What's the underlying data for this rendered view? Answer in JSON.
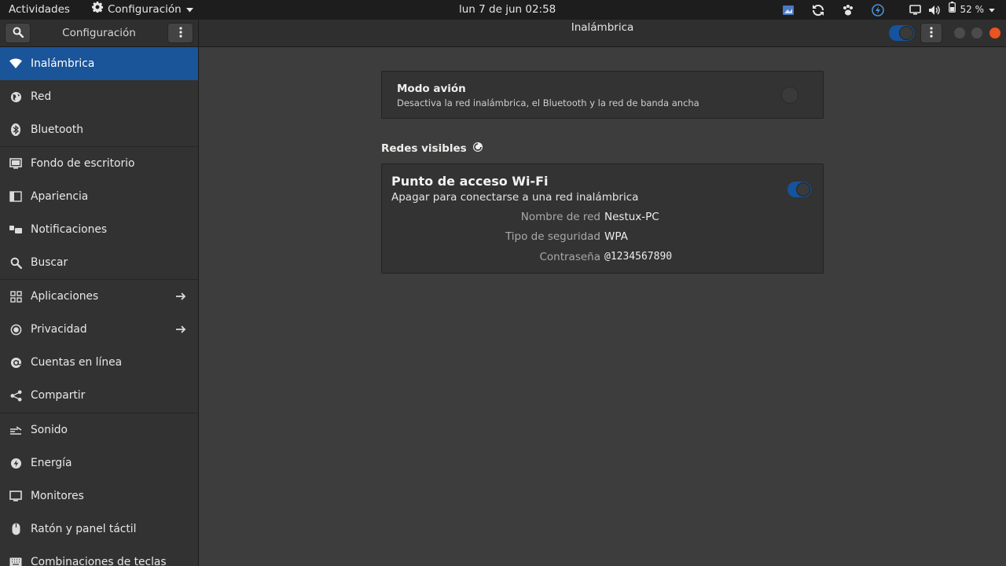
{
  "topbar": {
    "activities": "Actividades",
    "app_menu": "Configuración",
    "clock": "lun  7 de jun  02:58",
    "battery": "52 %",
    "tray_icons": [
      "screenshot-icon",
      "sync-icon",
      "paw-icon",
      "power-circle-icon",
      "display-icon",
      "volume-icon",
      "battery-icon"
    ]
  },
  "header": {
    "left_title": "Configuración",
    "title": "Inalámbrica"
  },
  "sidebar": {
    "items": [
      {
        "label": "Inalámbrica",
        "icon": "wifi-icon"
      },
      {
        "label": "Red",
        "icon": "globe-icon"
      },
      {
        "label": "Bluetooth",
        "icon": "bluetooth-icon"
      },
      {
        "label": "Fondo de escritorio",
        "icon": "monitor-icon"
      },
      {
        "label": "Apariencia",
        "icon": "appearance-icon"
      },
      {
        "label": "Notificaciones",
        "icon": "notifications-icon"
      },
      {
        "label": "Buscar",
        "icon": "search-icon"
      },
      {
        "label": "Aplicaciones",
        "icon": "grid-icon"
      },
      {
        "label": "Privacidad",
        "icon": "privacy-icon"
      },
      {
        "label": "Cuentas en línea",
        "icon": "at-icon"
      },
      {
        "label": "Compartir",
        "icon": "share-icon"
      },
      {
        "label": "Sonido",
        "icon": "sound-icon"
      },
      {
        "label": "Energía",
        "icon": "power-icon"
      },
      {
        "label": "Monitores",
        "icon": "display-icon"
      },
      {
        "label": "Ratón y panel táctil",
        "icon": "mouse-icon"
      },
      {
        "label": "Combinaciones de teclas",
        "icon": "keyboard-icon"
      }
    ]
  },
  "main": {
    "airplane": {
      "title": "Modo avión",
      "subtitle": "Desactiva la red inalámbrica, el Bluetooth y la red de banda ancha",
      "enabled": false
    },
    "visible_networks": "Redes visibles",
    "hotspot": {
      "title": "Punto de acceso Wi-Fi",
      "subtitle": "Apagar para conectarse a una red inalámbrica",
      "enabled": true,
      "rows": [
        {
          "label": "Nombre de red",
          "value": "Nestux-PC"
        },
        {
          "label": "Tipo de seguridad",
          "value": "WPA"
        },
        {
          "label": "Contraseña",
          "value": "@1234567890"
        }
      ]
    }
  },
  "colors": {
    "accent": "#15539e",
    "selection": "#1a5499",
    "close": "#e95420"
  }
}
